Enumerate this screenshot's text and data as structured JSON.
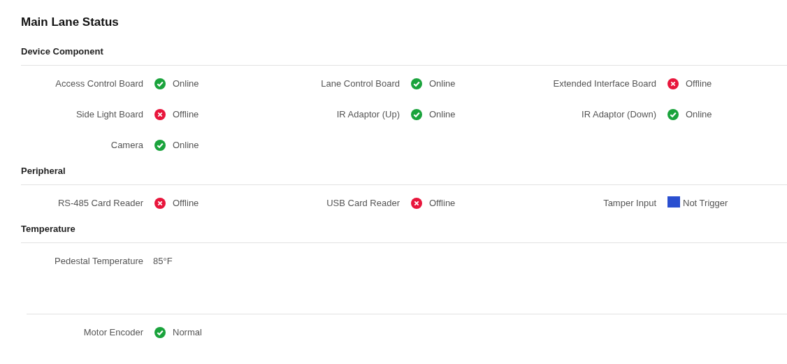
{
  "title": "Main Lane Status",
  "sections": [
    {
      "heading": "Device Component",
      "items": [
        {
          "label": "Access Control Board",
          "kind": "check",
          "value": "Online"
        },
        {
          "label": "Lane Control Board",
          "kind": "check",
          "value": "Online"
        },
        {
          "label": "Extended Interface Board",
          "kind": "cross",
          "value": "Offline"
        },
        {
          "label": "Side Light Board",
          "kind": "cross",
          "value": "Offline"
        },
        {
          "label": "IR Adaptor (Up)",
          "kind": "check",
          "value": "Online"
        },
        {
          "label": "IR Adaptor (Down)",
          "kind": "check",
          "value": "Online"
        },
        {
          "label": "Camera",
          "kind": "check",
          "value": "Online"
        }
      ]
    },
    {
      "heading": "Peripheral",
      "items": [
        {
          "label": "RS-485 Card Reader",
          "kind": "cross",
          "value": "Offline"
        },
        {
          "label": "USB Card Reader",
          "kind": "cross",
          "value": "Offline"
        },
        {
          "label": "Tamper Input",
          "kind": "square",
          "value": "Not Trigger"
        }
      ]
    },
    {
      "heading": "Temperature",
      "items": [
        {
          "label": "Pedestal Temperature",
          "kind": "plain",
          "value": "85°F"
        }
      ]
    },
    {
      "items": [
        {
          "label": "Motor Encoder",
          "kind": "check",
          "value": "Normal"
        }
      ]
    }
  ]
}
